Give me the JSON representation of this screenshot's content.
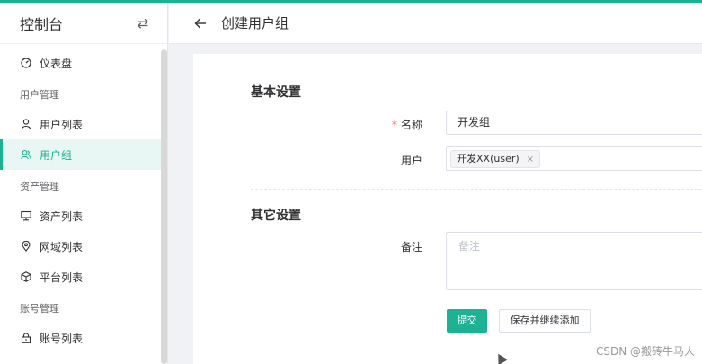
{
  "sidebar": {
    "title": "控制台",
    "items": [
      {
        "type": "item",
        "label": "仪表盘",
        "icon": "dashboard-icon"
      },
      {
        "type": "group",
        "label": "用户管理"
      },
      {
        "type": "item",
        "label": "用户列表",
        "icon": "user-icon"
      },
      {
        "type": "item",
        "label": "用户组",
        "icon": "user-group-icon",
        "active": true
      },
      {
        "type": "group",
        "label": "资产管理"
      },
      {
        "type": "item",
        "label": "资产列表",
        "icon": "monitor-icon"
      },
      {
        "type": "item",
        "label": "网域列表",
        "icon": "location-icon"
      },
      {
        "type": "item",
        "label": "平台列表",
        "icon": "cube-icon"
      },
      {
        "type": "group",
        "label": "账号管理"
      },
      {
        "type": "item",
        "label": "账号列表",
        "icon": "lock-icon"
      }
    ]
  },
  "header": {
    "title": "创建用户组"
  },
  "form": {
    "basic_title": "基本设置",
    "name_label": "名称",
    "name_value": "开发组",
    "users_label": "用户",
    "user_tag": "开发XX(user)",
    "tag_close": "×",
    "other_title": "其它设置",
    "remark_label": "备注",
    "remark_placeholder": "备注",
    "submit_label": "提交",
    "save_continue_label": "保存并继续添加"
  },
  "watermark": "CSDN @搬砖牛马人",
  "colors": {
    "accent": "#1ab394",
    "required": "#f56c6c"
  }
}
